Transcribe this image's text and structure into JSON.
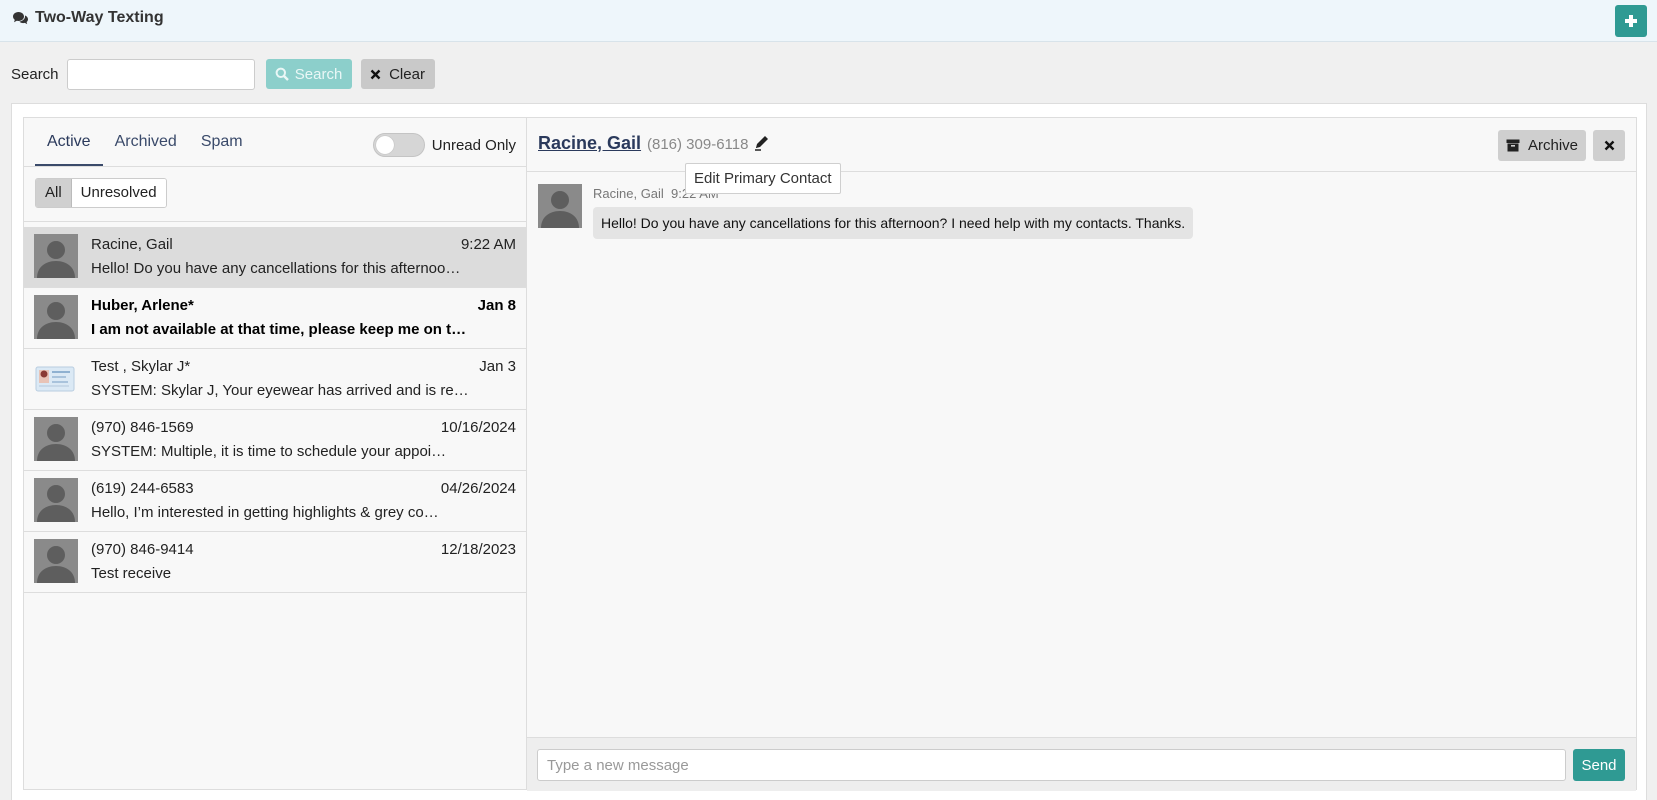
{
  "header": {
    "title": "Two-Way Texting"
  },
  "search": {
    "label": "Search",
    "placeholder": "",
    "search_label": "Search",
    "clear_label": "Clear"
  },
  "tabs": {
    "items": [
      "Active",
      "Archived",
      "Spam"
    ],
    "active": "Active",
    "unread_only_label": "Unread Only"
  },
  "filters": {
    "all_label": "All",
    "unresolved_label": "Unresolved"
  },
  "conversations": [
    {
      "name": "Racine, Gail",
      "time": "9:22 AM",
      "preview": "Hello! Do you have any cancellations for this afternoo…",
      "selected": true,
      "unread": false,
      "avatar": "person-avatar"
    },
    {
      "name": "Huber, Arlene*",
      "time": "Jan 8",
      "preview": "I am not available at that time, please keep me on th…",
      "selected": false,
      "unread": true,
      "avatar": "person-avatar"
    },
    {
      "name": "Test , Skylar J*",
      "time": "Jan 3",
      "preview": "SYSTEM: Skylar J, Your eyewear has arrived and is rea…",
      "selected": false,
      "unread": false,
      "avatar": "id-card-avatar"
    },
    {
      "name": "(970) 846-1569",
      "time": "10/16/2024",
      "preview": "SYSTEM: Multiple, it is time to schedule your appoi…",
      "selected": false,
      "unread": false,
      "avatar": "person-avatar"
    },
    {
      "name": "(619) 244-6583",
      "time": "04/26/2024",
      "preview": "Hello, I’m interested in getting highlights & grey co…",
      "selected": false,
      "unread": false,
      "avatar": "person-avatar"
    },
    {
      "name": "(970) 846-9414",
      "time": "12/18/2023",
      "preview": "Test receive",
      "selected": false,
      "unread": false,
      "avatar": "person-avatar"
    }
  ],
  "thread": {
    "contact_name": "Racine, Gail",
    "contact_phone": "(816) 309-6118",
    "edit_tooltip": "Edit Primary Contact",
    "archive_label": "Archive",
    "messages": [
      {
        "sender": "Racine, Gail",
        "time": "9:22 AM",
        "text": "Hello! Do you have any cancellations for this afternoon? I need help with my contacts. Thanks."
      }
    ]
  },
  "composer": {
    "placeholder": "Type a new message",
    "send_label": "Send"
  },
  "colors": {
    "accent": "#2f9a93",
    "header_bg": "#eef6fb",
    "selected_row": "#dcdcdc"
  }
}
